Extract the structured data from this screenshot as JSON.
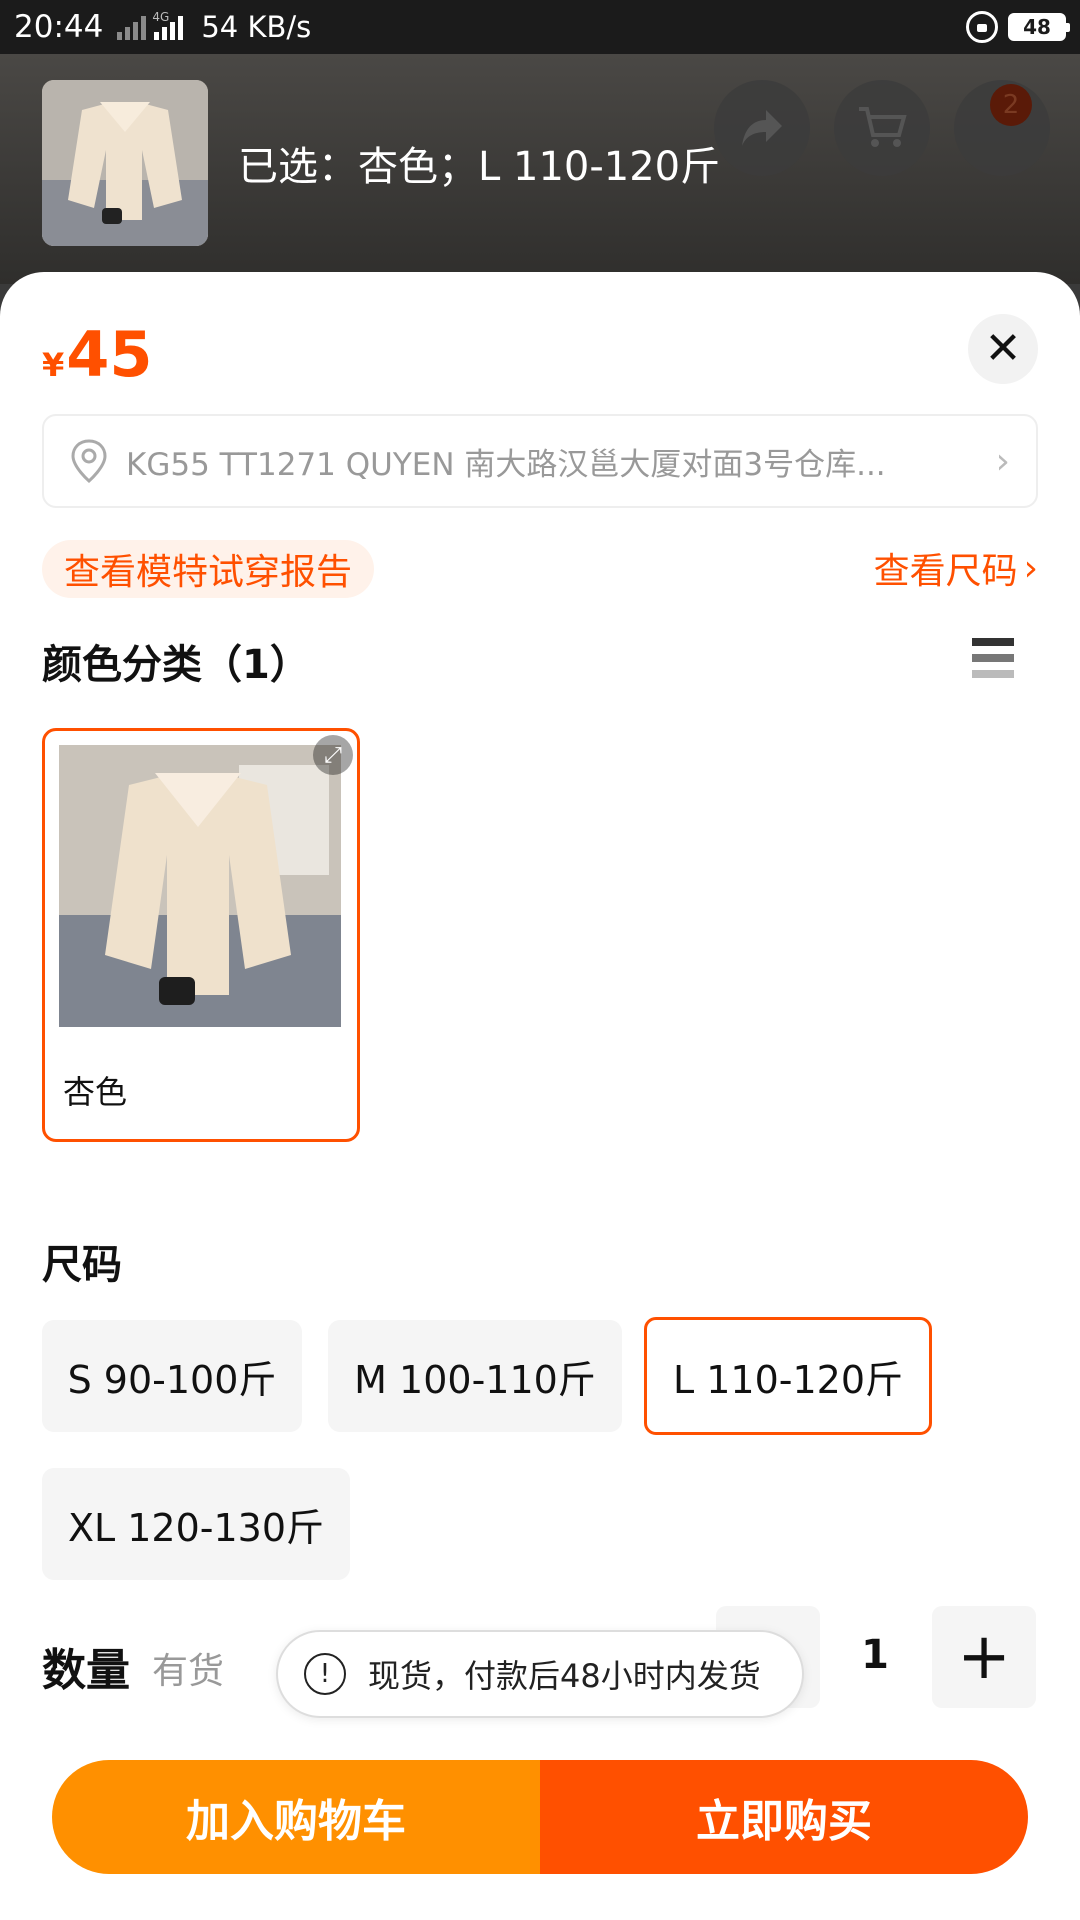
{
  "status_bar": {
    "time": "20:44",
    "network_tag": "4G",
    "speed": "54 KB/s",
    "battery": "48"
  },
  "background": {
    "cart_badge": "2"
  },
  "header": {
    "selected_text": "已选：杏色；L 110-120斤"
  },
  "price": {
    "currency": "¥",
    "amount": "45"
  },
  "address": {
    "text": "KG55 TT1271 QUYEN 南大路汉邕大厦对面3号仓库..."
  },
  "links": {
    "model_report": "查看模特试穿报告",
    "size_chart": "查看尺码"
  },
  "color_section": {
    "title": "颜色分类（1）",
    "options": [
      {
        "label": "杏色",
        "selected": true
      }
    ]
  },
  "size_section": {
    "title": "尺码",
    "options": [
      {
        "label": "S 90-100斤",
        "selected": false
      },
      {
        "label": "M 100-110斤",
        "selected": false
      },
      {
        "label": "L 110-120斤",
        "selected": true
      },
      {
        "label": "XL 120-130斤",
        "selected": false
      }
    ]
  },
  "quantity": {
    "label": "数量",
    "stock": "有货",
    "value": "1",
    "plus": "+"
  },
  "toast": {
    "text": "现货，付款后48小时内发货",
    "icon": "!"
  },
  "actions": {
    "add_to_cart": "加入购物车",
    "buy_now": "立即购买"
  },
  "colors": {
    "accent": "#ff5000",
    "cart_button": "#ff9000"
  }
}
